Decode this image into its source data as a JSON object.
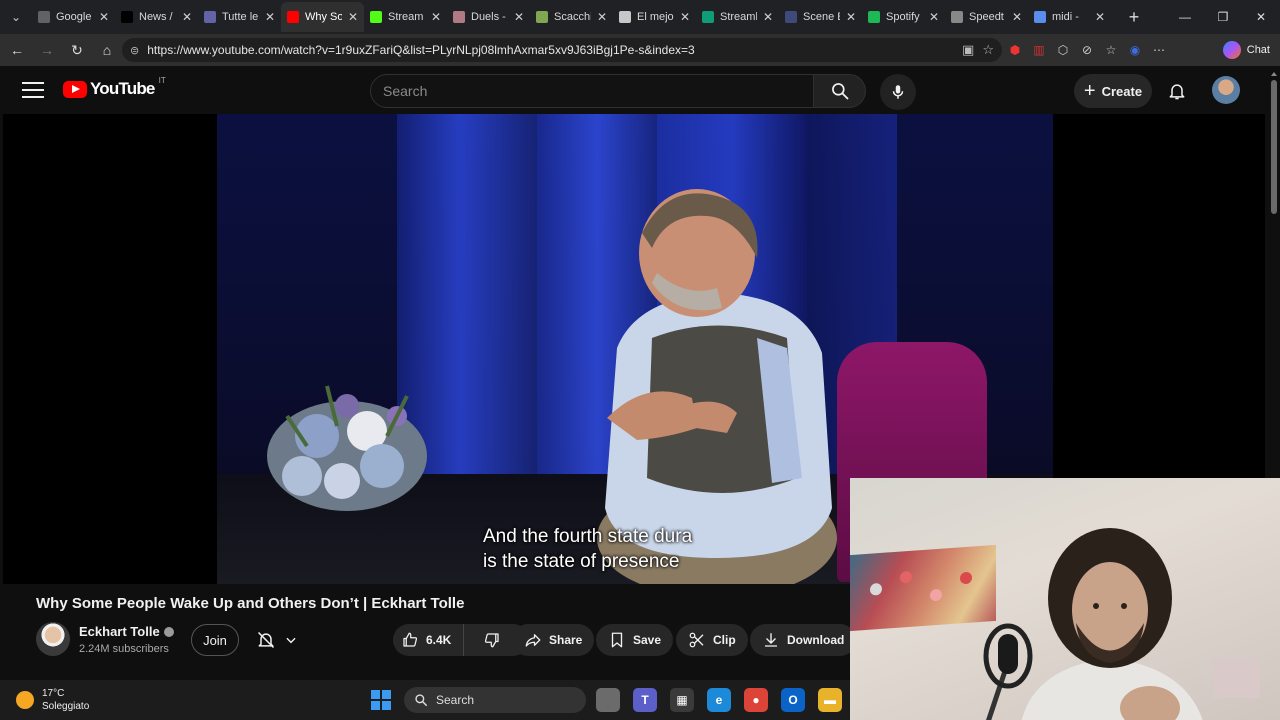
{
  "browser": {
    "tabs": [
      {
        "label": "Google",
        "favicon": "google-icon",
        "color": "#5f6368",
        "active": false
      },
      {
        "label": "News /",
        "favicon": "x-icon",
        "color": "#000000",
        "active": false
      },
      {
        "label": "Tutte le",
        "favicon": "teams-icon",
        "color": "#6264a7",
        "active": false
      },
      {
        "label": "Why So",
        "favicon": "youtube-icon",
        "color": "#ff0000",
        "active": true
      },
      {
        "label": "Stream",
        "favicon": "kick-icon",
        "color": "#53fc18",
        "active": false
      },
      {
        "label": "Duels -",
        "favicon": "pin-icon",
        "color": "#b07a85",
        "active": false
      },
      {
        "label": "Scacchi",
        "favicon": "chess-pawn-icon",
        "color": "#7fa650",
        "active": false
      },
      {
        "label": "El mejo",
        "favicon": "gem-icon",
        "color": "#c8c8c8",
        "active": false
      },
      {
        "label": "Streaml",
        "favicon": "stream-icon",
        "color": "#0f9d77",
        "active": false
      },
      {
        "label": "Scene E",
        "favicon": "cloud-icon",
        "color": "#3d4a7a",
        "active": false
      },
      {
        "label": "Spotify",
        "favicon": "spotify-icon",
        "color": "#1db954",
        "active": false
      },
      {
        "label": "Speedt",
        "favicon": "speedtest-icon",
        "color": "#888888",
        "active": false
      },
      {
        "label": "midi - ",
        "favicon": "search-icon",
        "color": "#5b8def",
        "active": false
      }
    ],
    "new_tab": "+",
    "url": "https://www.youtube.com/watch?v=1r9uxZFariQ&list=PLyrNLpj08lmhAxmar5xv9J63iBgj1Pe-s&index=3",
    "copilot_label": "Chat"
  },
  "youtube": {
    "logo_text": "YouTube",
    "country_code": "IT",
    "search_placeholder": "Search",
    "create_label": "Create",
    "video": {
      "subtitle_line1": "And the fourth state dura",
      "subtitle_line2": "is the state of presence"
    },
    "title": "Why Some People Wake Up and Others Don’t | Eckhart Tolle",
    "channel": {
      "name": "Eckhart Tolle",
      "subscribers": "2.24M subscribers",
      "join_label": "Join"
    },
    "actions": {
      "likes": "6.4K",
      "share": "Share",
      "save": "Save",
      "clip": "Clip",
      "download": "Download"
    }
  },
  "taskbar": {
    "temperature": "17°C",
    "condition": "Soleggiato",
    "search_label": "Search",
    "apps": [
      {
        "name": "task-view-icon",
        "color": "#6b6b6b",
        "glyph": ""
      },
      {
        "name": "teams-app-icon",
        "color": "#5b5fc7",
        "glyph": "T"
      },
      {
        "name": "calculator-icon",
        "color": "#3a3a3a",
        "glyph": "▦"
      },
      {
        "name": "edge-icon",
        "color": "#1c8ad8",
        "glyph": "e"
      },
      {
        "name": "chrome-icon",
        "color": "#db4437",
        "glyph": "●"
      },
      {
        "name": "outlook-icon",
        "color": "#0a64c8",
        "glyph": "O"
      },
      {
        "name": "file-explorer-icon",
        "color": "#e8b32a",
        "glyph": "▬"
      }
    ]
  }
}
